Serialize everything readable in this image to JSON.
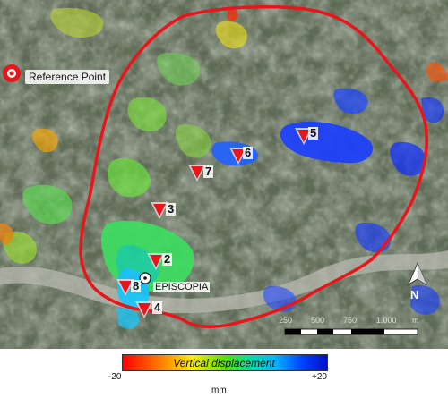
{
  "map": {
    "reference_point_label": "Reference Point",
    "town_label": "EPISCOPIA",
    "north_label": "N",
    "points": [
      {
        "id": "1",
        "label": "2"
      },
      {
        "id": "2",
        "label": "3"
      },
      {
        "id": "3",
        "label": "4"
      },
      {
        "id": "4",
        "label": "5"
      },
      {
        "id": "5",
        "label": "6"
      },
      {
        "id": "6",
        "label": "7"
      },
      {
        "id": "7",
        "label": "8"
      }
    ],
    "scale_bar": {
      "labels": [
        "250",
        "500",
        "750",
        "1.000"
      ],
      "unit": "m"
    }
  },
  "legend": {
    "min_label": "-20",
    "max_label": "+20",
    "title": "Vertical displacement",
    "unit": "mm",
    "colors": [
      "#ff0000",
      "#ff7a00",
      "#ffee00",
      "#55e000",
      "#00e0a0",
      "#00b8ff",
      "#0040ff",
      "#0010c8"
    ]
  }
}
